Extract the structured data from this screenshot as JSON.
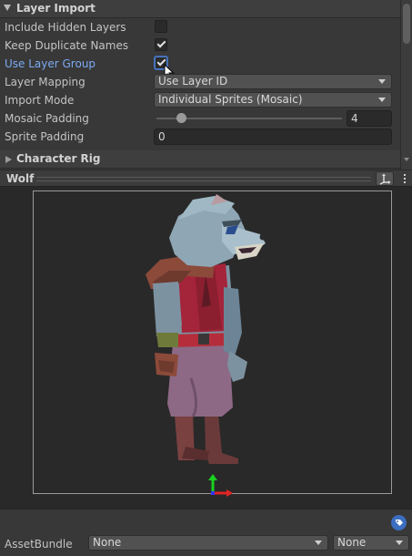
{
  "inspector": {
    "layer_import": {
      "title": "Layer Import",
      "expanded": true
    },
    "rows": {
      "include_hidden": {
        "label": "Include Hidden Layers",
        "checked": false
      },
      "keep_duplicate": {
        "label": "Keep Duplicate Names",
        "checked": true
      },
      "use_layer_group": {
        "label": "Use Layer Group",
        "checked": true
      },
      "layer_mapping": {
        "label": "Layer Mapping",
        "value": "Use Layer ID"
      },
      "import_mode": {
        "label": "Import Mode",
        "value": "Individual Sprites (Mosaic)"
      },
      "mosaic_padding": {
        "label": "Mosaic Padding",
        "value": "4",
        "slider_fraction": 0.14
      },
      "sprite_padding": {
        "label": "Sprite Padding",
        "value": "0"
      }
    },
    "character_rig": {
      "title": "Character Rig",
      "expanded": false
    }
  },
  "preview": {
    "title": "Wolf",
    "pivot_icon": "pivot-icon",
    "menu_icon": "kebab-menu-icon"
  },
  "footer": {
    "asset_bundle_label": "AssetBundle",
    "bundle_name": "None",
    "bundle_variant": "None",
    "tag_icon": "tag-icon"
  },
  "colors": {
    "panel_bg": "#383838",
    "preview_bg": "#292929",
    "accent_label": "#7caaf2",
    "tag_blue": "#3b6dc0"
  }
}
